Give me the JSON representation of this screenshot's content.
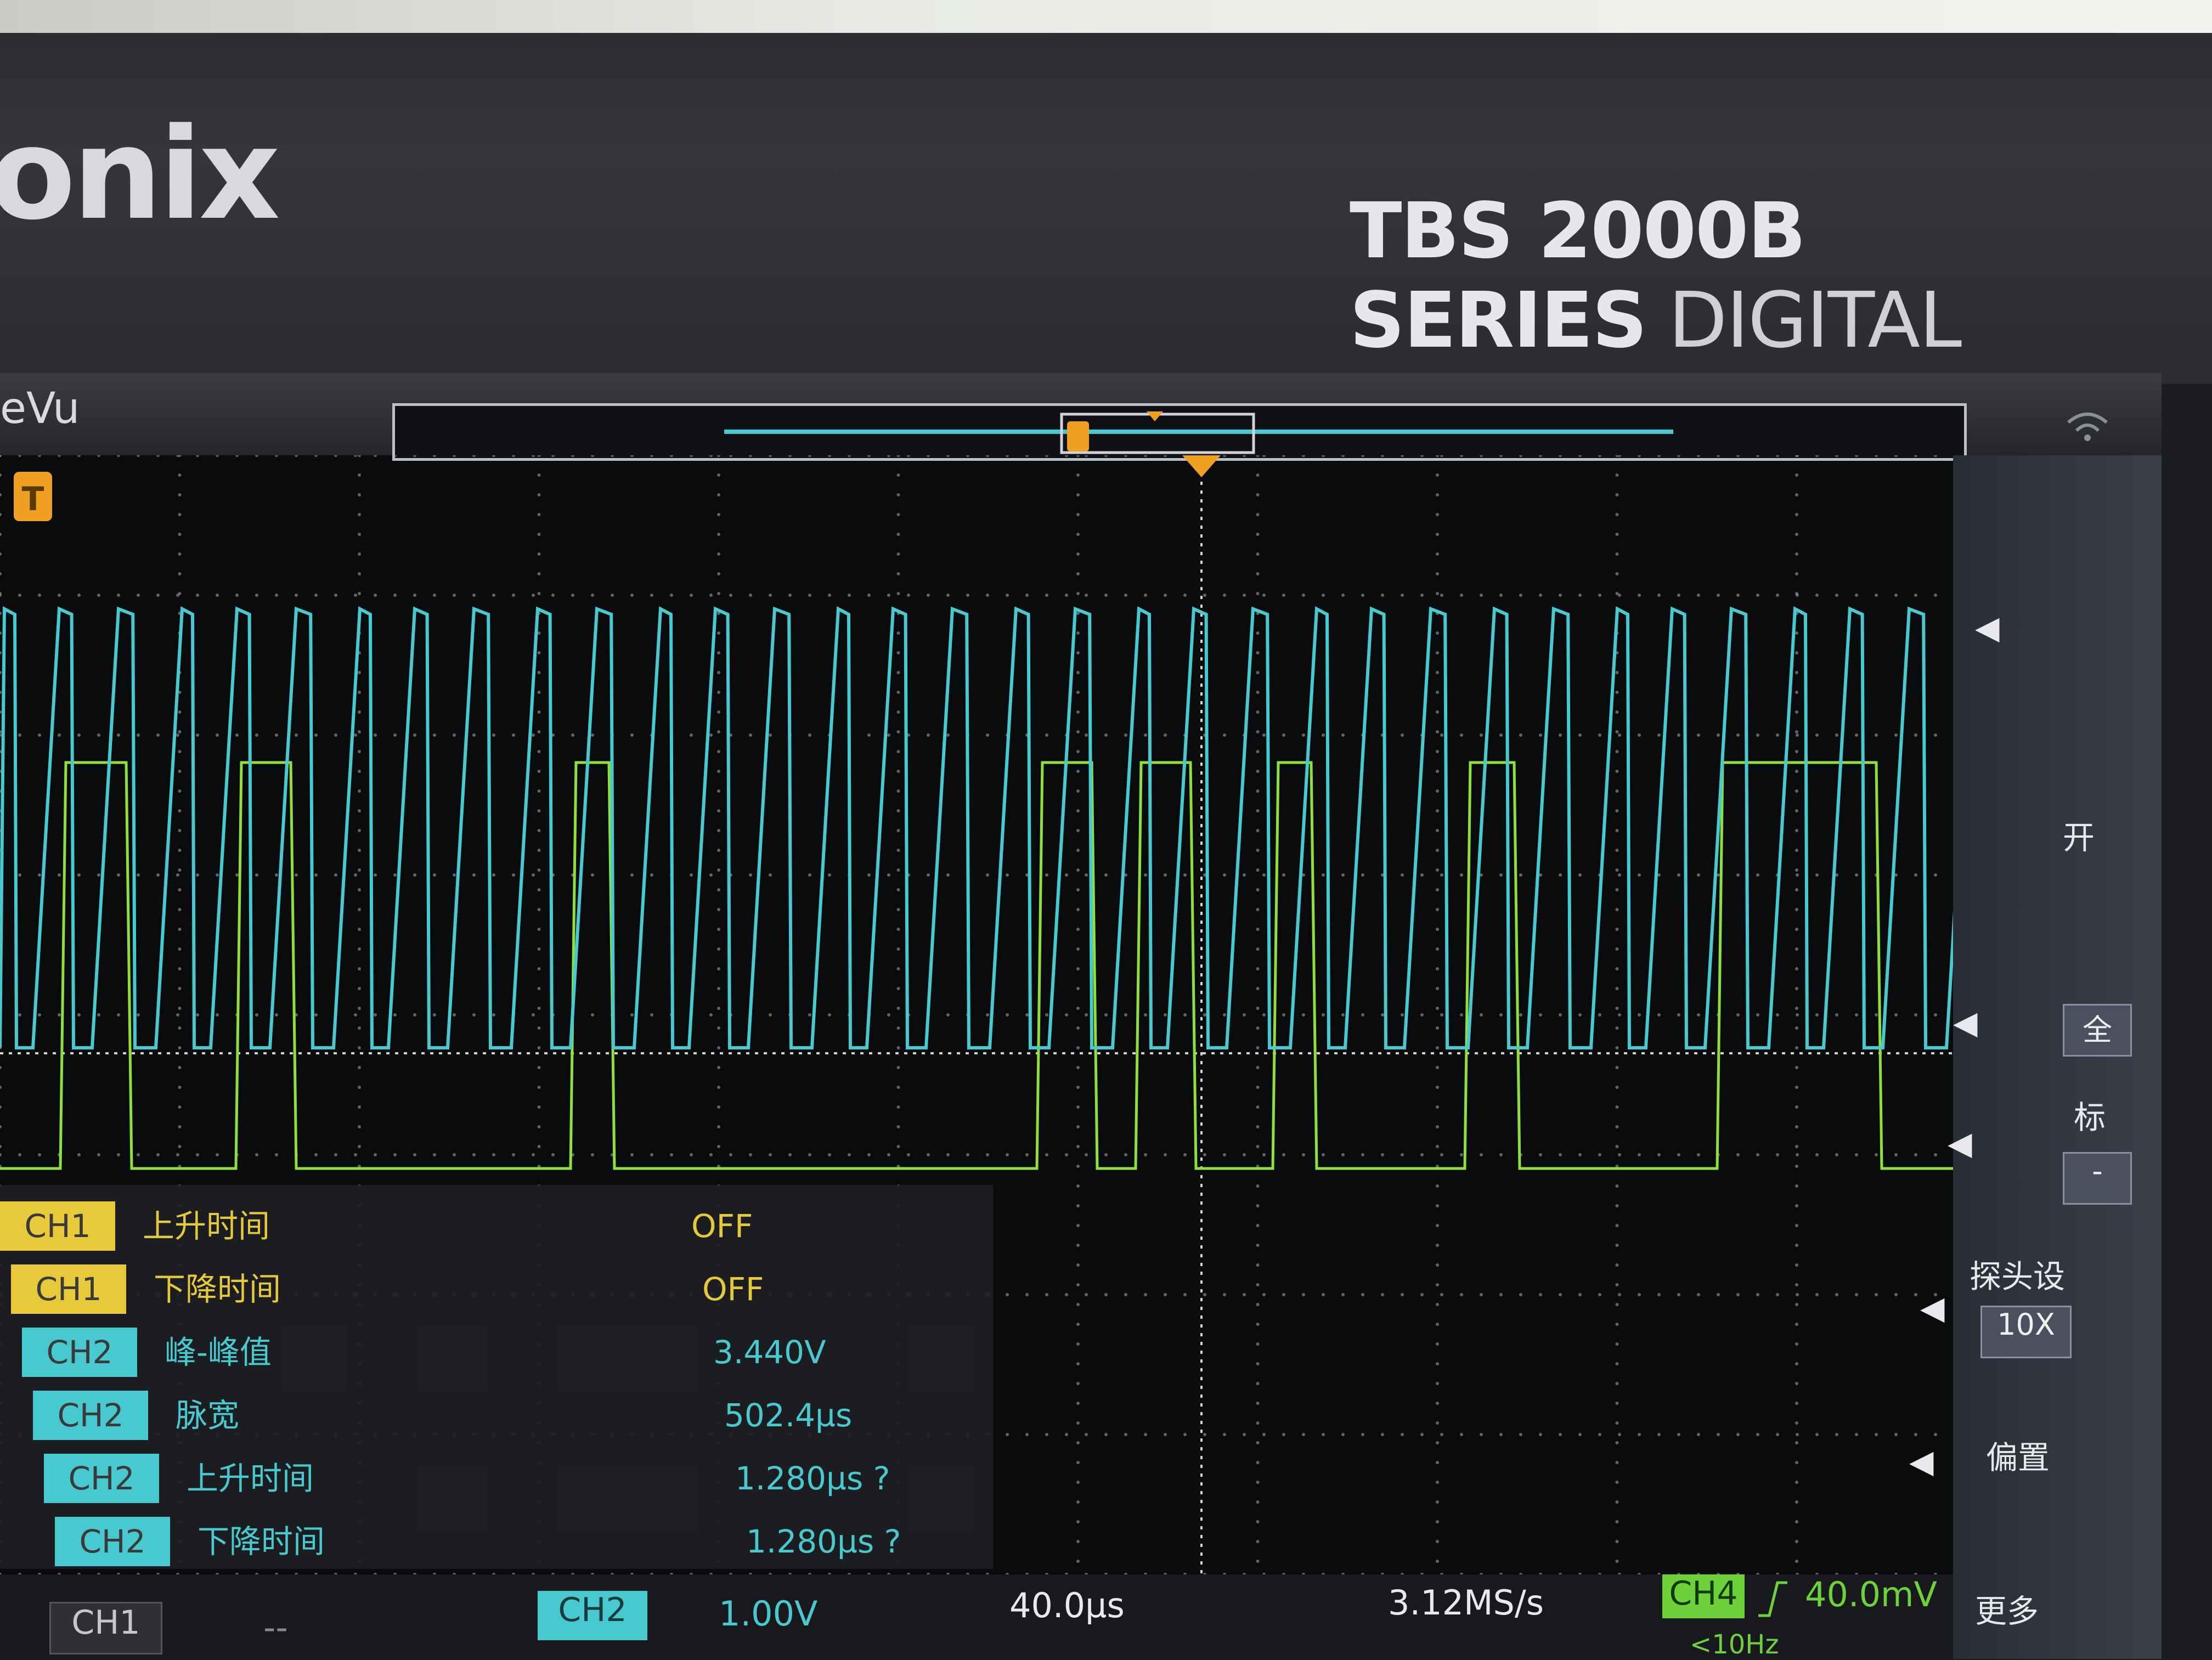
{
  "bezel": {
    "brand": "onix",
    "model": "TBS 2000B SERIES",
    "model_suffix": "DIGITAL"
  },
  "screen": {
    "topbar_label": "eVu",
    "trigger_marker": "T"
  },
  "right_panel": {
    "item_open": "开",
    "item_all": "全",
    "item_mark": "标",
    "item_mark_value": "-",
    "probe_setting": "探头设",
    "probe_value": "10X",
    "offset": "偏置",
    "more": "更多"
  },
  "measurements": [
    {
      "channel": "CH1",
      "name": "上升时间",
      "value": "OFF",
      "color": "yellow"
    },
    {
      "channel": "CH1",
      "name": "下降时间",
      "value": "OFF",
      "color": "yellow"
    },
    {
      "channel": "CH2",
      "name": "峰-峰值",
      "value": "3.440V",
      "color": "cyan"
    },
    {
      "channel": "CH2",
      "name": "脉宽",
      "value": "502.4µs",
      "color": "cyan"
    },
    {
      "channel": "CH2",
      "name": "上升时间",
      "value": "1.280µs ?",
      "color": "cyan"
    },
    {
      "channel": "CH2",
      "name": "下降时间",
      "value": "1.280µs ?",
      "color": "cyan"
    }
  ],
  "bottom_bar": {
    "ch1_label": "CH1",
    "ch1_value": "--",
    "ch2_label": "CH2",
    "ch2_value": "1.00V",
    "timebase": "40.0µs",
    "sample_rate": "3.12MS/s",
    "trigger_source": "CH4",
    "trigger_level": "40.0mV",
    "freq_partial": "<10Hz"
  },
  "colors": {
    "ch1": "#e6c93a",
    "ch2": "#47c9cf",
    "ch4": "#8fe03a",
    "grid": "#9aa0a6",
    "trigger": "#f0a020"
  }
}
